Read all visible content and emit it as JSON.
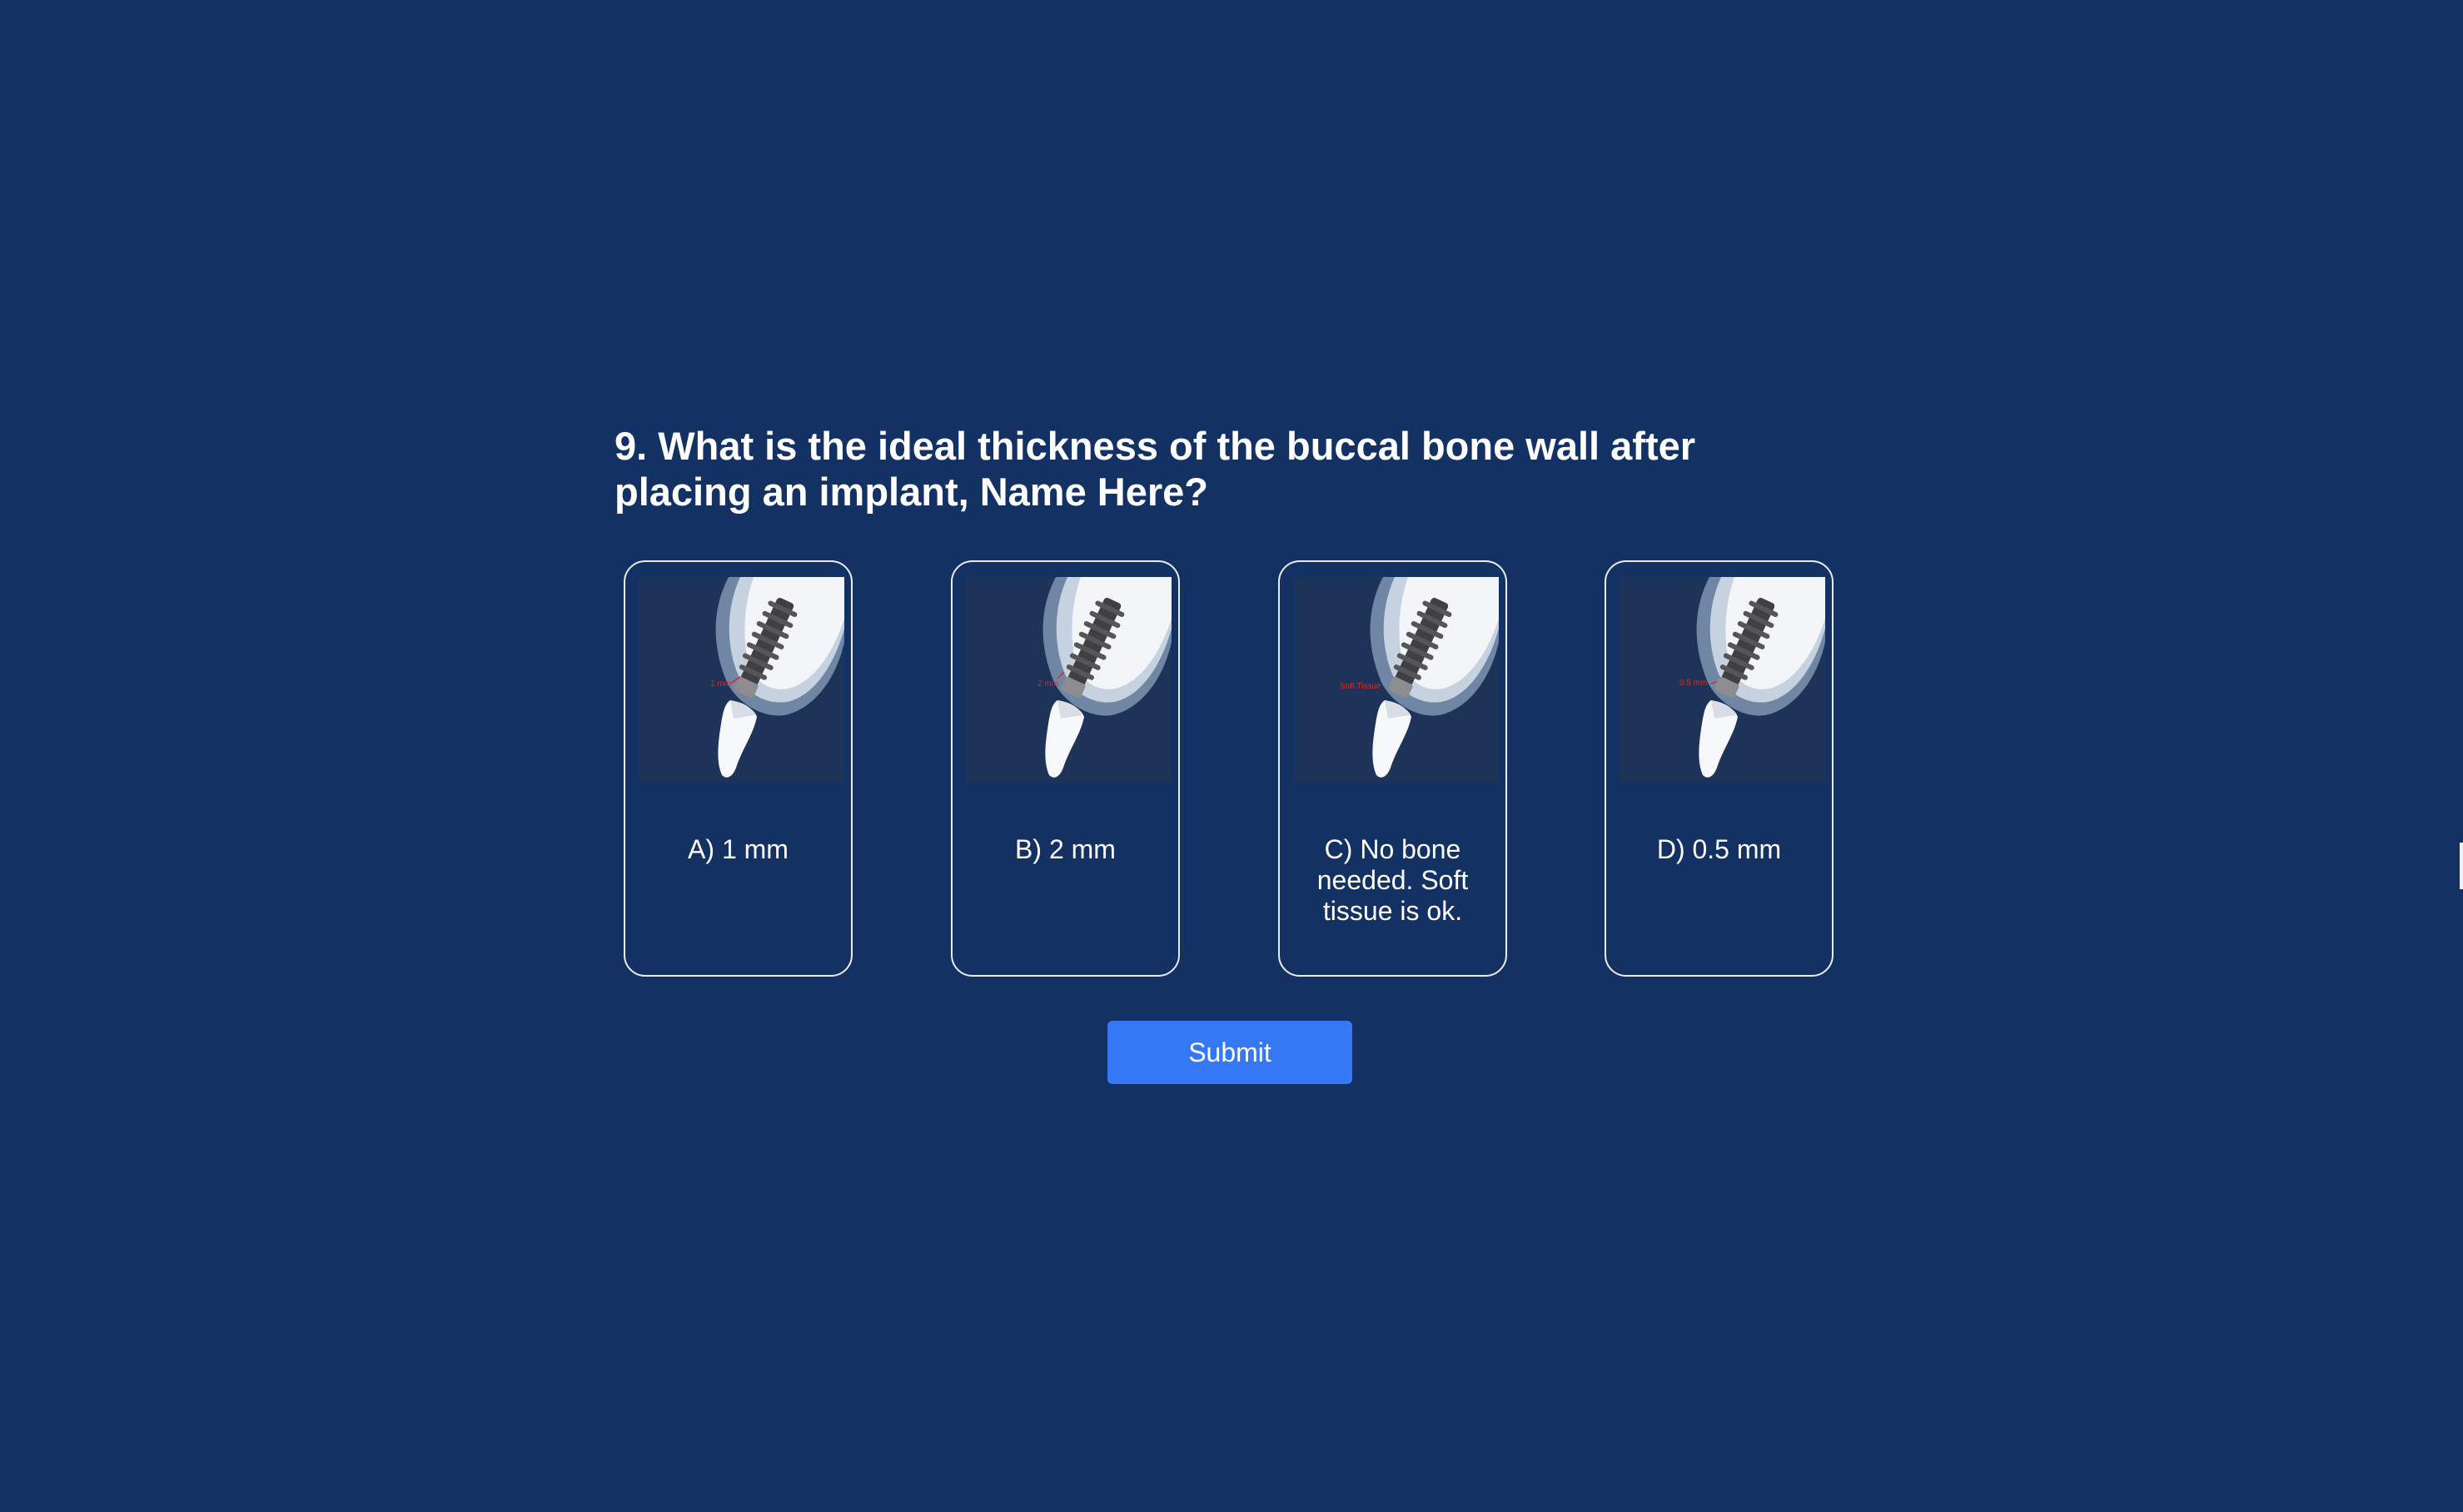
{
  "question": {
    "text": "9. What is the ideal thickness of the buccal bone wall after placing an implant, Name Here?"
  },
  "options": [
    {
      "label": "A) 1 mm",
      "annotation": "1 mm",
      "image": "dental-implant-diagram"
    },
    {
      "label": "B) 2 mm",
      "annotation": "2 mm",
      "image": "dental-implant-diagram"
    },
    {
      "label": "C) No bone needed. Soft tissue is ok.",
      "annotation": "Soft Tissue",
      "image": "dental-implant-diagram"
    },
    {
      "label": "D) 0.5 mm",
      "annotation": "0.5 mm",
      "image": "dental-implant-diagram"
    }
  ],
  "submit": {
    "label": "Submit"
  },
  "colors": {
    "background": "#133163",
    "card_border": "#e9ecf3",
    "button": "#3478f5",
    "annotation": "#e02424"
  }
}
